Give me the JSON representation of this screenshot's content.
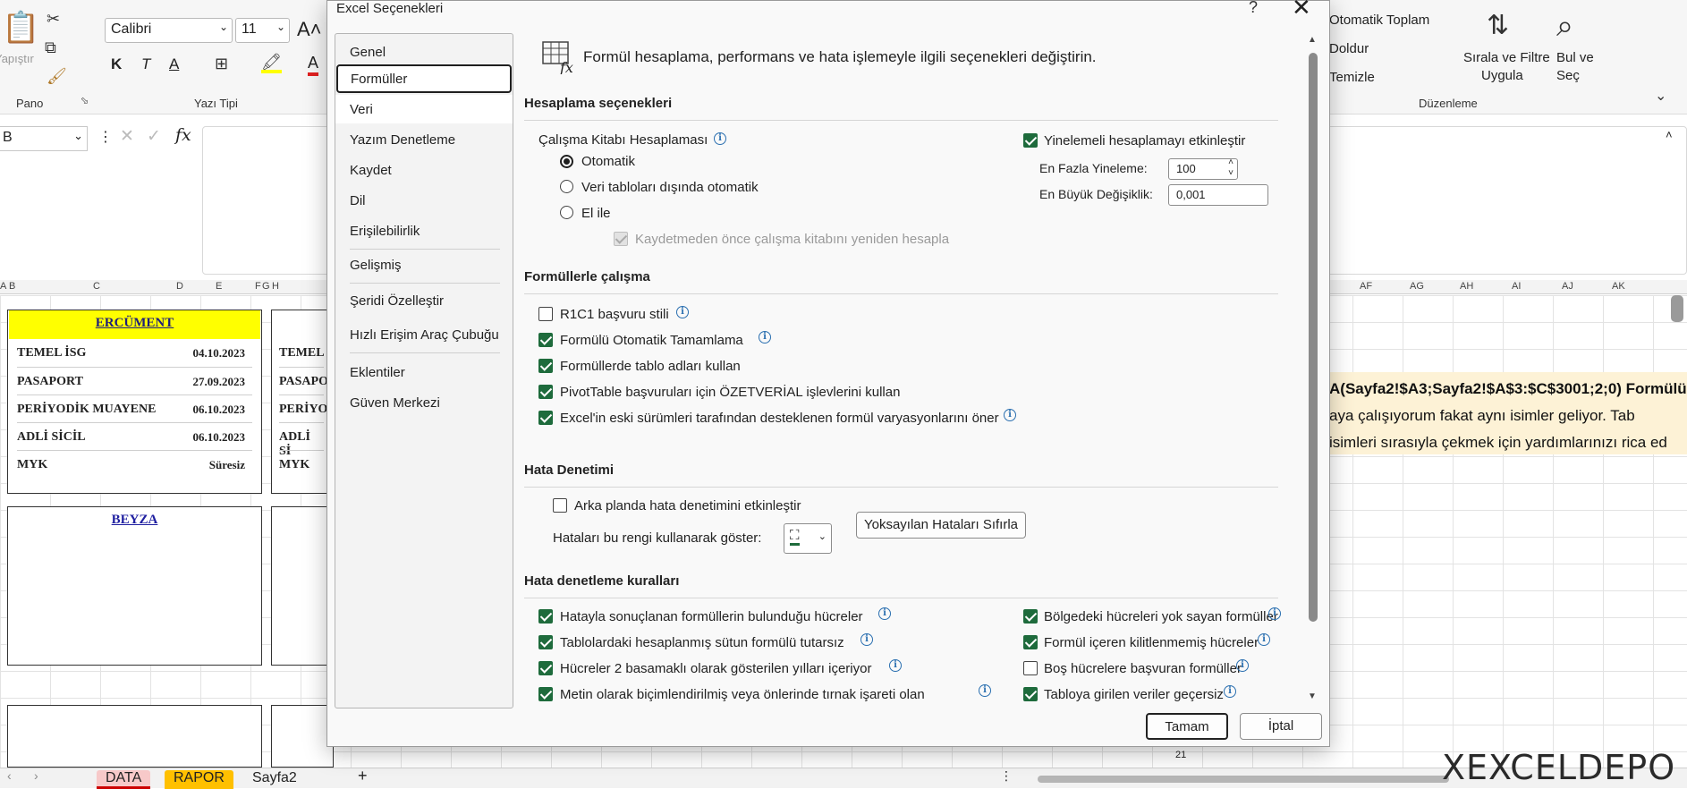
{
  "excel": {
    "ribbon": {
      "paste_label": "Yapıştır",
      "clipboard_group": "Pano",
      "font_name": "Calibri",
      "font_size": "11",
      "font_group": "Yazı Tipi",
      "bold": "K",
      "italic": "T",
      "underline": "A",
      "autosum": "Otomatik Toplam",
      "fill": "Doldur",
      "clear": "Temizle",
      "sort_filter_line1": "Sırala ve Filtre",
      "sort_filter_line2": "Uygula",
      "find_line1": "Bul ve",
      "find_line2": "Seç",
      "editing_group": "Düzenleme"
    },
    "formula_bar": {
      "name_box": "B",
      "fx": "fx"
    },
    "columns": [
      "A",
      "B",
      "C",
      "D",
      "E",
      "F",
      "G",
      "H",
      "AF",
      "AG",
      "AH",
      "AI",
      "AJ",
      "AK"
    ],
    "card1": {
      "title": "ERCÜMENT",
      "rows": [
        {
          "label": "TEMEL İSG",
          "value": "04.10.2023"
        },
        {
          "label": "PASAPORT",
          "value": "27.09.2023"
        },
        {
          "label": "PERİYODİK MUAYENE",
          "value": "06.10.2023"
        },
        {
          "label": "ADLİ SİCİL",
          "value": "06.10.2023"
        },
        {
          "label": "MYK",
          "value": "Süresiz"
        }
      ]
    },
    "card2": {
      "rows": [
        "TEMEL",
        "PASAPO",
        "PERİYO",
        "ADLİ Sİ",
        "MYK"
      ]
    },
    "card3": {
      "title": "BEYZA"
    },
    "note_lines": [
      "A(Sayfa2!$A3;Sayfa2!$A$3:$C$3001;2;0) Formülü",
      "aya çalışıyorum fakat aynı isimler geliyor. Tab",
      "isimleri sırasıyla çekmek için yardımlarınızı rica ed"
    ],
    "sheet_tabs": [
      "DATA",
      "RAPOR",
      "Sayfa2"
    ],
    "row_number": "21",
    "watermark": "XEXCELDEPO"
  },
  "dialog": {
    "title": "Excel Seçenekleri",
    "help": "?",
    "close": "✕",
    "nav": [
      "Genel",
      "Formüller",
      "Veri",
      "Yazım Denetleme",
      "Kaydet",
      "Dil",
      "Erişilebilirlik",
      "Gelişmiş",
      "Şeridi Özelleştir",
      "Hızlı Erişim Araç Çubuğu",
      "Eklentiler",
      "Güven Merkezi"
    ],
    "selected_nav": "Formüller",
    "header_text": "Formül hesaplama, performans ve hata işlemeyle ilgili seçenekleri değiştirin.",
    "calc": {
      "heading": "Hesaplama seçenekleri",
      "workbook_calc": "Çalışma Kitabı Hesaplaması",
      "automatic": "Otomatik",
      "auto_except_tables": "Veri tabloları dışında otomatik",
      "manual": "El ile",
      "recalc_before_save": "Kaydetmeden önce çalışma kitabını yeniden hesapla",
      "enable_iterative": "Yinelemeli hesaplamayı etkinleştir",
      "max_iterations_label": "En Fazla Yineleme:",
      "max_iterations_value": "100",
      "max_change_label": "En Büyük Değişiklik:",
      "max_change_value": "0,001"
    },
    "formulas": {
      "heading": "Formüllerle çalışma",
      "items": [
        {
          "label": "R1C1 başvuru stili",
          "checked": false
        },
        {
          "label": "Formülü Otomatik Tamamlama",
          "checked": true
        },
        {
          "label": "Formüllerde tablo adları kullan",
          "checked": true
        },
        {
          "label": "PivotTable başvuruları için ÖZETVERİAL işlevlerini kullan",
          "checked": true
        },
        {
          "label": "Excel'in eski sürümleri tarafından desteklenen formül varyasyonlarını öner",
          "checked": true
        }
      ]
    },
    "error_check": {
      "heading": "Hata Denetimi",
      "background_check": "Arka planda hata denetimini etkinleştir",
      "color_label": "Hataları bu rengi kullanarak göster:",
      "reset_button": "Yoksayılan Hataları Sıfırla"
    },
    "rules": {
      "heading": "Hata denetleme kuralları",
      "left": [
        {
          "label": "Hatayla sonuçlanan formüllerin bulunduğu hücreler",
          "checked": true
        },
        {
          "label": "Tablolardaki hesaplanmış sütun formülü tutarsız",
          "checked": true
        },
        {
          "label": "Hücreler 2 basamaklı olarak gösterilen yılları içeriyor",
          "checked": true
        },
        {
          "label": "Metin olarak biçimlendirilmiş veya önlerinde tırnak işareti olan",
          "checked": true
        }
      ],
      "right": [
        {
          "label": "Bölgedeki hücreleri yok sayan formüller",
          "checked": true
        },
        {
          "label": "Formül içeren kilitlenmemiş hücreler",
          "checked": true
        },
        {
          "label": "Boş hücrelere başvuran formüller",
          "checked": false
        },
        {
          "label": "Tabloya girilen veriler geçersiz",
          "checked": true
        }
      ]
    },
    "ok": "Tamam",
    "cancel": "İptal",
    "colors": {
      "accent_check": "#1e6b3c",
      "note_bg": "#fdf2d6",
      "title_yellow": "#ffff00"
    }
  }
}
